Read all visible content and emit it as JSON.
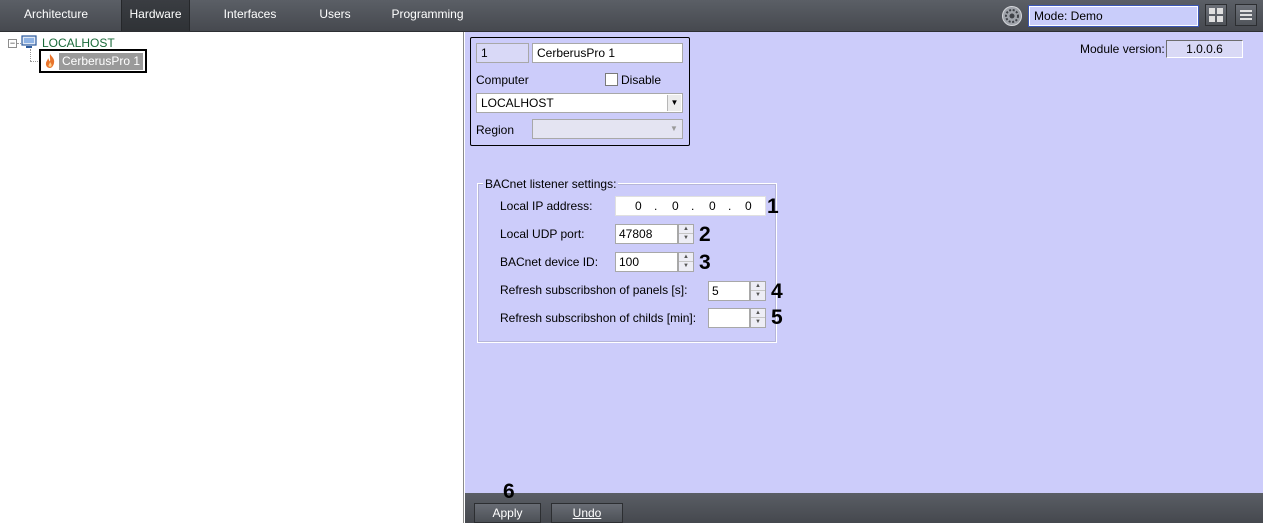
{
  "nav": {
    "tabs": [
      {
        "label": "Architecture"
      },
      {
        "label": "Hardware",
        "active": true
      },
      {
        "label": "Interfaces"
      },
      {
        "label": "Users"
      },
      {
        "label": "Programming"
      }
    ],
    "mode": "Mode: Demo",
    "icons": [
      "settings-gear-icon",
      "layout-grid-icon",
      "menu-icon"
    ]
  },
  "tree": {
    "root_label": "LOCALHOST",
    "root_icon": "computer-icon",
    "child_label": "CerberusPro 1",
    "child_icon": "fire-icon"
  },
  "device": {
    "id": "1",
    "name": "CerberusPro 1",
    "computer_label": "Computer",
    "disable_label": "Disable",
    "disable_checked": false,
    "computer_value": "LOCALHOST",
    "region_label": "Region",
    "region_value": "",
    "module_version_label": "Module version:",
    "module_version": "1.0.0.6"
  },
  "bacnet": {
    "legend": "BACnet listener settings:",
    "local_ip_label": "Local IP address:",
    "ip": [
      "0",
      "0",
      "0",
      "0"
    ],
    "ip_separator": ".",
    "udp_port_label": "Local UDP port:",
    "udp_port": "47808",
    "device_id_label": "BACnet device ID:",
    "device_id": "100",
    "refresh_panels_label": "Refresh subscribshon of panels [s]:",
    "refresh_panels": "5",
    "refresh_childs_label": "Refresh subscribshon of childs [min]:",
    "refresh_childs": ""
  },
  "callouts": [
    "1",
    "2",
    "3",
    "4",
    "5",
    "6"
  ],
  "footer": {
    "apply_label": "Apply",
    "undo_label": "Undo"
  },
  "colors": {
    "panel_bg": "#ccccfa",
    "nav_bg": "#4f5359",
    "mode_field_bg": "#c9cdfa",
    "tree_root_text": "#1a6b3a",
    "fire_icon": "#e8742c"
  }
}
